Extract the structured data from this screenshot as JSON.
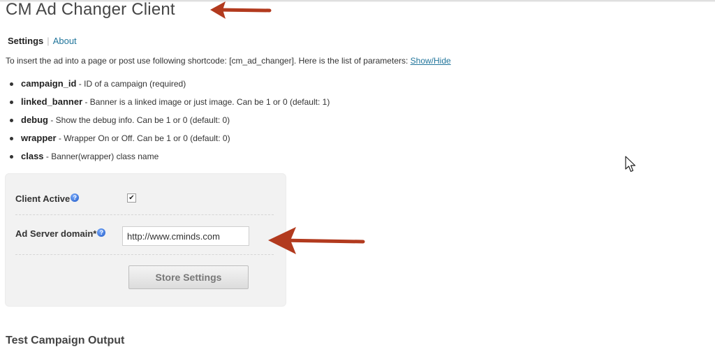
{
  "page": {
    "title": "CM Ad Changer Client"
  },
  "subnav": {
    "settings_label": "Settings",
    "separator": "|",
    "about_label": "About"
  },
  "intro": {
    "text": "To insert the ad into a page or post use following shortcode: [cm_ad_changer]. Here is the list of parameters: ",
    "toggle_link": "Show/Hide"
  },
  "params": [
    {
      "name": "campaign_id",
      "desc": " - ID of a campaign (required)"
    },
    {
      "name": "linked_banner",
      "desc": " - Banner is a linked image or just image. Can be 1 or 0 (default: 1)"
    },
    {
      "name": "debug",
      "desc": " - Show the debug info. Can be 1 or 0 (default: 0)"
    },
    {
      "name": "wrapper",
      "desc": " - Wrapper On or Off. Can be 1 or 0 (default: 0)"
    },
    {
      "name": "class",
      "desc": " - Banner(wrapper) class name"
    }
  ],
  "settings": {
    "client_active_label": "Client Active",
    "client_active_checked": true,
    "check_glyph": "✔",
    "ad_server_label": "Ad Server domain*",
    "ad_server_value": "http://www.cminds.com",
    "help_glyph": "?",
    "store_button": "Store Settings"
  },
  "test_section": {
    "heading": "Test Campaign Output"
  },
  "colors": {
    "link": "#21759b",
    "annotation_arrow": "#b23a1e",
    "panel_bg": "#f2f2f2"
  }
}
